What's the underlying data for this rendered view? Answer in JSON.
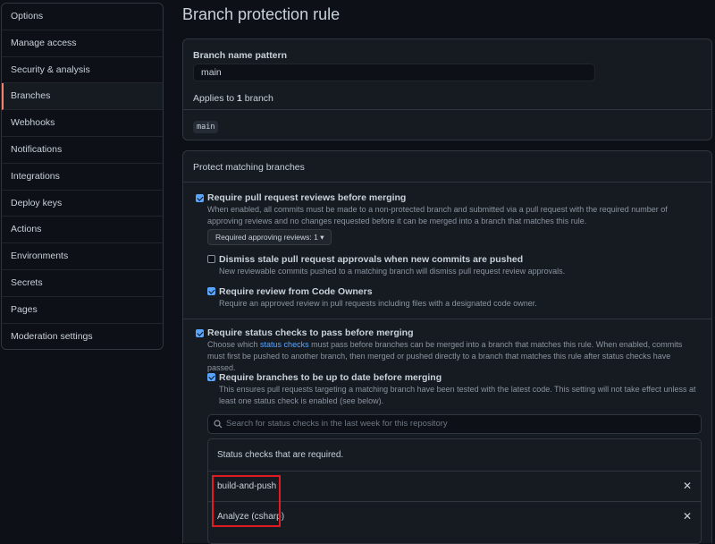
{
  "sidebar": {
    "items": [
      {
        "label": "Options"
      },
      {
        "label": "Manage access"
      },
      {
        "label": "Security & analysis"
      },
      {
        "label": "Branches",
        "active": true
      },
      {
        "label": "Webhooks"
      },
      {
        "label": "Notifications"
      },
      {
        "label": "Integrations"
      },
      {
        "label": "Deploy keys"
      },
      {
        "label": "Actions"
      },
      {
        "label": "Environments"
      },
      {
        "label": "Secrets"
      },
      {
        "label": "Pages"
      },
      {
        "label": "Moderation settings"
      }
    ]
  },
  "page": {
    "title": "Branch protection rule"
  },
  "pattern": {
    "label": "Branch name pattern",
    "value": "main",
    "applies_prefix": "Applies to ",
    "applies_count": "1",
    "applies_suffix": " branch",
    "matched_branch": "main"
  },
  "protect": {
    "header": "Protect matching branches",
    "require_reviews": {
      "checked": true,
      "title": "Require pull request reviews before merging",
      "desc": "When enabled, all commits must be made to a non-protected branch and submitted via a pull request with the required number of approving reviews and no changes requested before it can be merged into a branch that matches this rule.",
      "dropdown": "Required approving reviews: 1"
    },
    "dismiss_stale": {
      "checked": false,
      "title": "Dismiss stale pull request approvals when new commits are pushed",
      "desc": "New reviewable commits pushed to a matching branch will dismiss pull request review approvals."
    },
    "code_owners": {
      "checked": true,
      "title": "Require review from Code Owners",
      "desc": "Require an approved review in pull requests including files with a designated code owner."
    },
    "status_checks": {
      "checked": true,
      "title": "Require status checks to pass before merging",
      "desc_pre": "Choose which ",
      "desc_link": "status checks",
      "desc_post": " must pass before branches can be merged into a branch that matches this rule. When enabled, commits must first be pushed to another branch, then merged or pushed directly to a branch that matches this rule after status checks have passed."
    },
    "up_to_date": {
      "checked": true,
      "title": "Require branches to be up to date before merging",
      "desc": "This ensures pull requests targeting a matching branch have been tested with the latest code. This setting will not take effect unless at least one status check is enabled (see below)."
    },
    "search_placeholder": "Search for status checks in the last week for this repository",
    "required_header": "Status checks that are required.",
    "required_checks": [
      {
        "name": "build-and-push"
      },
      {
        "name": "Analyze (csharp)"
      }
    ]
  },
  "colors": {
    "background": "#0d1117",
    "panel": "#161b22",
    "border": "#30363d",
    "accent": "#58a6ff",
    "active_marker": "#f78166",
    "highlight": "#e01b24"
  }
}
